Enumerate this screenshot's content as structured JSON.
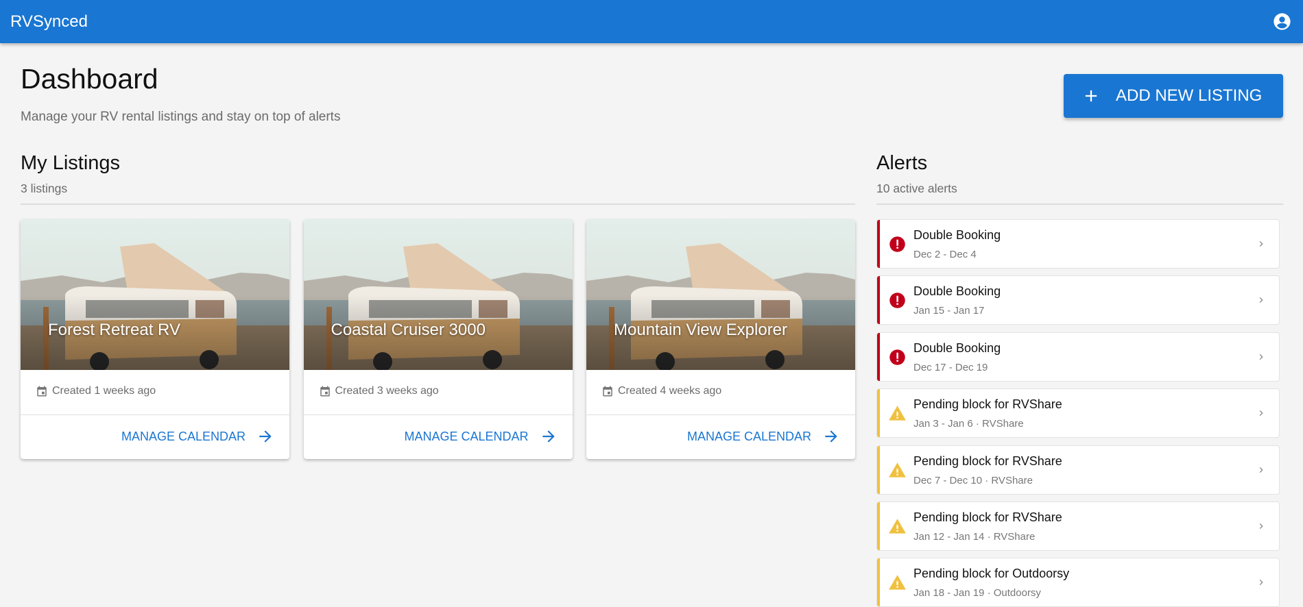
{
  "app": {
    "title": "RVSynced",
    "account_icon": "account-circle-icon"
  },
  "header": {
    "title": "Dashboard",
    "subtitle": "Manage your RV rental listings and stay on top of alerts",
    "add_button": "ADD NEW LISTING"
  },
  "listings": {
    "title": "My Listings",
    "count": "3 listings",
    "items": [
      {
        "name": "Forest Retreat RV",
        "created": "Created 1 weeks ago",
        "action": "MANAGE CALENDAR"
      },
      {
        "name": "Coastal Cruiser 3000",
        "created": "Created 3 weeks ago",
        "action": "MANAGE CALENDAR"
      },
      {
        "name": "Mountain View Explorer",
        "created": "Created 4 weeks ago",
        "action": "MANAGE CALENDAR"
      }
    ]
  },
  "alerts": {
    "title": "Alerts",
    "count": "10 active alerts",
    "colors": {
      "error": "#c0001a",
      "warning": "#f0c040"
    },
    "items": [
      {
        "severity": "error",
        "title": "Double Booking",
        "detail": "Dec 2 - Dec 4"
      },
      {
        "severity": "error",
        "title": "Double Booking",
        "detail": "Jan 15 - Jan 17"
      },
      {
        "severity": "error",
        "title": "Double Booking",
        "detail": "Dec 17 - Dec 19"
      },
      {
        "severity": "warning",
        "title": "Pending block for RVShare",
        "detail": "Jan 3 - Jan 6 · RVShare"
      },
      {
        "severity": "warning",
        "title": "Pending block for RVShare",
        "detail": "Dec 7 - Dec 10 · RVShare"
      },
      {
        "severity": "warning",
        "title": "Pending block for RVShare",
        "detail": "Jan 12 - Jan 14 · RVShare"
      },
      {
        "severity": "warning",
        "title": "Pending block for Outdoorsy",
        "detail": "Jan 18 - Jan 19 · Outdoorsy"
      }
    ]
  }
}
